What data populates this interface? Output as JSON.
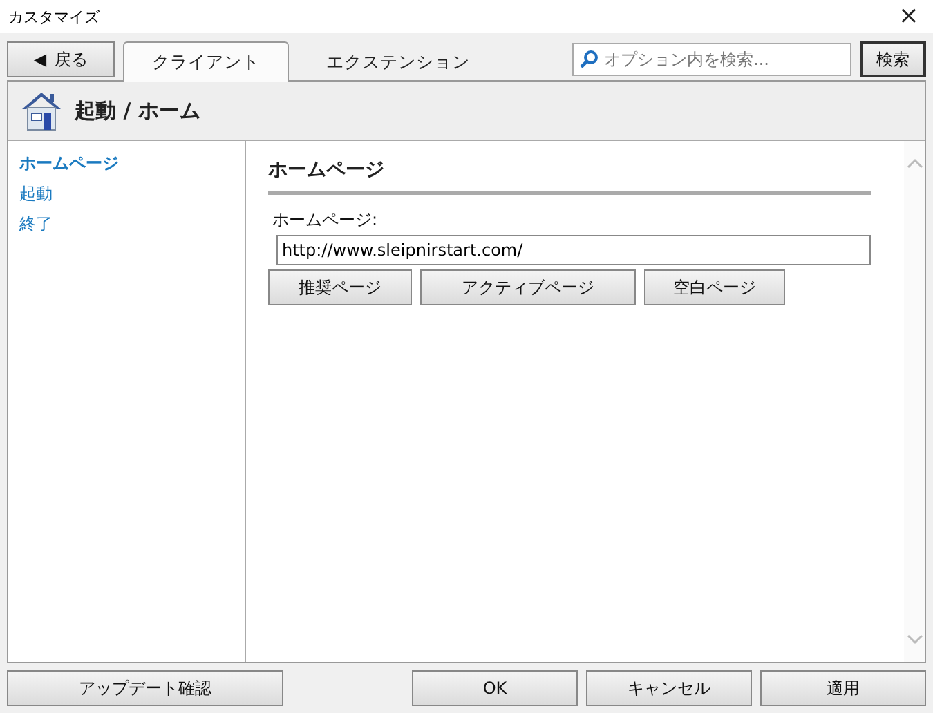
{
  "window": {
    "title": "カスタマイズ",
    "close": "×"
  },
  "back_button": {
    "arrow": "◀",
    "label": "戻る"
  },
  "tabs": [
    {
      "label": "クライアント",
      "selected": true
    },
    {
      "label": "エクステンション",
      "selected": false
    }
  ],
  "search": {
    "placeholder": "オプション内を検索...",
    "button": "検索"
  },
  "header": {
    "title": "起動 / ホーム"
  },
  "sidebar": {
    "items": [
      {
        "label": "ホームページ",
        "selected": true
      },
      {
        "label": "起動",
        "selected": false
      },
      {
        "label": "終了",
        "selected": false
      }
    ]
  },
  "section": {
    "title": "ホームページ",
    "field_label": "ホームページ:",
    "field_value": "http://www.sleipnirstart.com/",
    "buttons": [
      "推奨ページ",
      "アクティブページ",
      "空白ページ"
    ]
  },
  "footer": {
    "update_button": "アップデート確認",
    "buttons": [
      "OK",
      "キャンセル",
      "適用"
    ]
  }
}
